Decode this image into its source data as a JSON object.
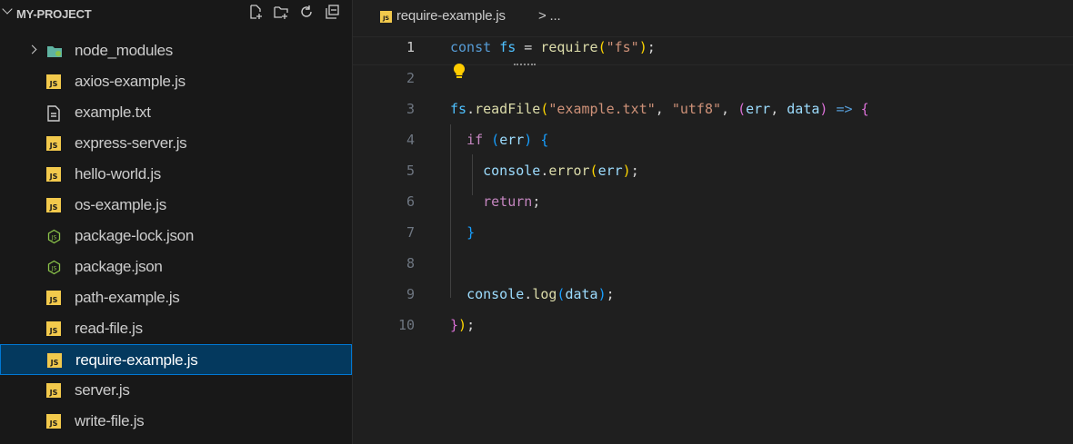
{
  "explorer": {
    "title": "MY-PROJECT",
    "actions": [
      "new-file-icon",
      "new-folder-icon",
      "refresh-icon",
      "collapse-all-icon"
    ],
    "items": [
      {
        "label": "node_modules",
        "type": "folder"
      },
      {
        "label": "axios-example.js",
        "type": "js"
      },
      {
        "label": "example.txt",
        "type": "txt"
      },
      {
        "label": "express-server.js",
        "type": "js"
      },
      {
        "label": "hello-world.js",
        "type": "js"
      },
      {
        "label": "os-example.js",
        "type": "js"
      },
      {
        "label": "package-lock.json",
        "type": "json"
      },
      {
        "label": "package.json",
        "type": "json"
      },
      {
        "label": "path-example.js",
        "type": "js"
      },
      {
        "label": "read-file.js",
        "type": "js"
      },
      {
        "label": "require-example.js",
        "type": "js",
        "selected": true
      },
      {
        "label": "server.js",
        "type": "js"
      },
      {
        "label": "write-file.js",
        "type": "js"
      }
    ],
    "js_badge": "JS"
  },
  "editor": {
    "breadcrumb": {
      "file": "require-example.js",
      "sep": "> ..."
    },
    "active_line": 1,
    "lines": [
      {
        "no": "1",
        "tokens": [
          [
            "const",
            "#569cd6"
          ],
          [
            " ",
            "#cccccc"
          ],
          [
            "fs",
            "#4fc1ff"
          ],
          [
            " = ",
            "#d4d4d4"
          ],
          [
            "require",
            "#dcdcaa"
          ],
          [
            "(",
            "#ffd700"
          ],
          [
            "\"fs\"",
            "#ce9178"
          ],
          [
            ")",
            "#ffd700"
          ],
          [
            ";",
            "#d4d4d4"
          ]
        ]
      },
      {
        "no": "2",
        "tokens": []
      },
      {
        "no": "3",
        "tokens": [
          [
            "fs",
            "#4fc1ff"
          ],
          [
            ".",
            "#d4d4d4"
          ],
          [
            "readFile",
            "#dcdcaa"
          ],
          [
            "(",
            "#ffd700"
          ],
          [
            "\"example.txt\"",
            "#ce9178"
          ],
          [
            ", ",
            "#d4d4d4"
          ],
          [
            "\"utf8\"",
            "#ce9178"
          ],
          [
            ", ",
            "#d4d4d4"
          ],
          [
            "(",
            "#da70d6"
          ],
          [
            "err",
            "#9cdcfe"
          ],
          [
            ", ",
            "#d4d4d4"
          ],
          [
            "data",
            "#9cdcfe"
          ],
          [
            ")",
            "#da70d6"
          ],
          [
            " ",
            "#d4d4d4"
          ],
          [
            "=>",
            "#569cd6"
          ],
          [
            " ",
            "#d4d4d4"
          ],
          [
            "{",
            "#da70d6"
          ]
        ]
      },
      {
        "no": "4",
        "tokens": [
          [
            "  ",
            "#d4d4d4"
          ],
          [
            "if",
            "#c586c0"
          ],
          [
            " ",
            "#d4d4d4"
          ],
          [
            "(",
            "#179fff"
          ],
          [
            "err",
            "#9cdcfe"
          ],
          [
            ")",
            "#179fff"
          ],
          [
            " ",
            "#d4d4d4"
          ],
          [
            "{",
            "#179fff"
          ]
        ]
      },
      {
        "no": "5",
        "tokens": [
          [
            "    ",
            "#d4d4d4"
          ],
          [
            "console",
            "#9cdcfe"
          ],
          [
            ".",
            "#d4d4d4"
          ],
          [
            "error",
            "#dcdcaa"
          ],
          [
            "(",
            "#ffd700"
          ],
          [
            "err",
            "#9cdcfe"
          ],
          [
            ")",
            "#ffd700"
          ],
          [
            ";",
            "#d4d4d4"
          ]
        ]
      },
      {
        "no": "6",
        "tokens": [
          [
            "    ",
            "#d4d4d4"
          ],
          [
            "return",
            "#c586c0"
          ],
          [
            ";",
            "#d4d4d4"
          ]
        ]
      },
      {
        "no": "7",
        "tokens": [
          [
            "  ",
            "#d4d4d4"
          ],
          [
            "}",
            "#179fff"
          ]
        ]
      },
      {
        "no": "8",
        "tokens": []
      },
      {
        "no": "9",
        "tokens": [
          [
            "  ",
            "#d4d4d4"
          ],
          [
            "console",
            "#9cdcfe"
          ],
          [
            ".",
            "#d4d4d4"
          ],
          [
            "log",
            "#dcdcaa"
          ],
          [
            "(",
            "#179fff"
          ],
          [
            "data",
            "#9cdcfe"
          ],
          [
            ")",
            "#179fff"
          ],
          [
            ";",
            "#d4d4d4"
          ]
        ]
      },
      {
        "no": "10",
        "tokens": [
          [
            "}",
            "#da70d6"
          ],
          [
            ")",
            "#ffd700"
          ],
          [
            ";",
            "#d4d4d4"
          ]
        ]
      }
    ]
  }
}
